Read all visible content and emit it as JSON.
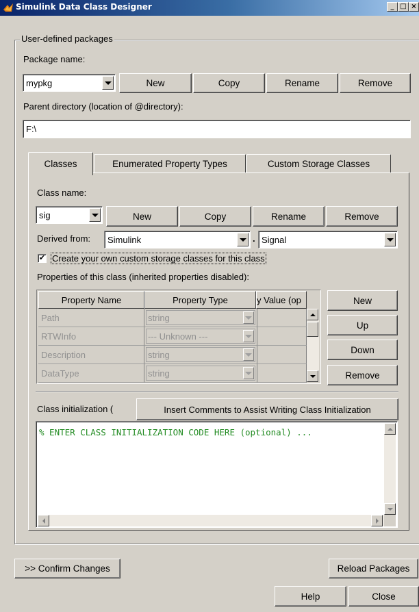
{
  "window": {
    "title": "Simulink Data Class Designer",
    "minimize": "_",
    "maximize": "□",
    "close": "×"
  },
  "packages": {
    "group_title": "User-defined packages",
    "package_name_label": "Package name:",
    "selected_package": "mypkg",
    "new_label": "New",
    "copy_label": "Copy",
    "rename_label": "Rename",
    "remove_label": "Remove",
    "parent_dir_label": "Parent directory (location of @directory):",
    "parent_dir_value": "F:\\"
  },
  "tabs": [
    {
      "label": "Classes",
      "active": true
    },
    {
      "label": "Enumerated Property Types",
      "active": false
    },
    {
      "label": "Custom Storage Classes",
      "active": false
    }
  ],
  "classes": {
    "class_name_label": "Class name:",
    "selected_class": "sig",
    "new_label": "New",
    "copy_label": "Copy",
    "rename_label": "Rename",
    "remove_label": "Remove",
    "derived_from_label": "Derived from:",
    "derived_package": "Simulink",
    "derived_separator": ".",
    "derived_class": "Signal",
    "custom_storage_checkbox_label": "Create your own custom storage classes for this class",
    "custom_storage_checked": true,
    "check_mark": "✔",
    "properties_label": "Properties of this class (inherited properties disabled):",
    "table": {
      "columns": [
        "Property Name",
        "Property Type",
        "y Value (op"
      ],
      "rows": [
        {
          "name": "Path",
          "type": "string"
        },
        {
          "name": "RTWInfo",
          "type": "--- Unknown ---"
        },
        {
          "name": "Description",
          "type": "string"
        },
        {
          "name": "DataType",
          "type": "string"
        }
      ]
    },
    "prop_buttons": {
      "new_label": "New",
      "up_label": "Up",
      "down_label": "Down",
      "remove_label": "Remove"
    },
    "init_label": "Class initialization (",
    "insert_comments_label": "Insert Comments to Assist Writing Class Initialization",
    "init_code": "% ENTER CLASS INITIALIZATION CODE HERE (optional) ..."
  },
  "footer": {
    "confirm_label": ">> Confirm Changes",
    "reload_label": "Reload Packages",
    "help_label": "Help",
    "close_label": "Close"
  }
}
